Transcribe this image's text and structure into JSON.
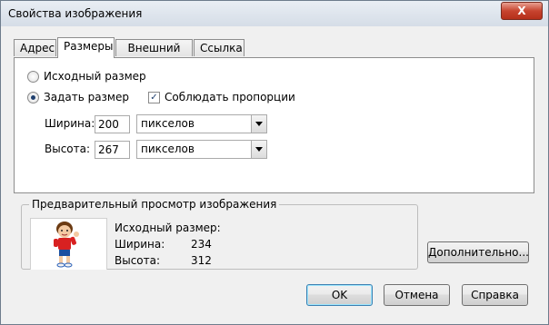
{
  "dialog": {
    "title": "Свойства изображения",
    "close_label": "X"
  },
  "tabs": [
    {
      "label": "Адрес"
    },
    {
      "label": "Размеры"
    },
    {
      "label": "Внешний вид"
    },
    {
      "label": "Ссылка"
    }
  ],
  "size": {
    "original_label": "Исходный размер",
    "custom_label": "Задать размер",
    "keep_ratio_label": "Соблюдать пропорции",
    "width_label": "Ширина:",
    "width_value": "200",
    "width_unit": "пикселов",
    "height_label": "Высота:",
    "height_value": "267",
    "height_unit": "пикселов"
  },
  "preview": {
    "title": "Предварительный просмотр изображения",
    "original_size_label": "Исходный размер:",
    "width_label": "Ширина:",
    "width_value": "234",
    "height_label": "Высота:",
    "height_value": "312"
  },
  "buttons": {
    "advanced": "Дополнительно...",
    "ok": "OK",
    "cancel": "Отмена",
    "help": "Справка"
  }
}
